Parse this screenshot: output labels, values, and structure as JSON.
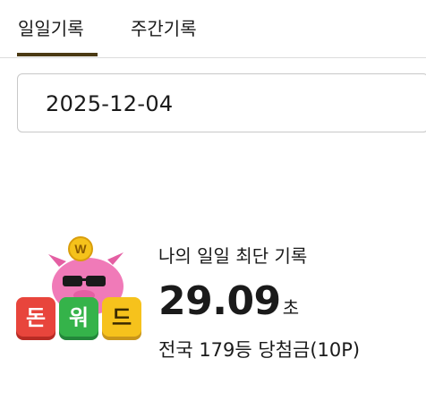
{
  "tabs": [
    {
      "label": "일일기록",
      "active": true
    },
    {
      "label": "주간기록",
      "active": false
    }
  ],
  "date_field": {
    "value": "2025-12-04"
  },
  "logo": {
    "letters": [
      "돈",
      "워",
      "드"
    ],
    "coin": "W"
  },
  "record": {
    "title": "나의 일일 최단 기록",
    "time": "29.09",
    "unit": "초",
    "rank_text": "전국 179등 당첨금(10P)"
  },
  "colors": {
    "tab_underline": "#4b3a14",
    "pig_pink": "#f07ab8",
    "coin_gold": "#f5c21b",
    "block_red": "#e8453c",
    "block_green": "#35b34a",
    "block_yellow": "#f6c21c"
  }
}
